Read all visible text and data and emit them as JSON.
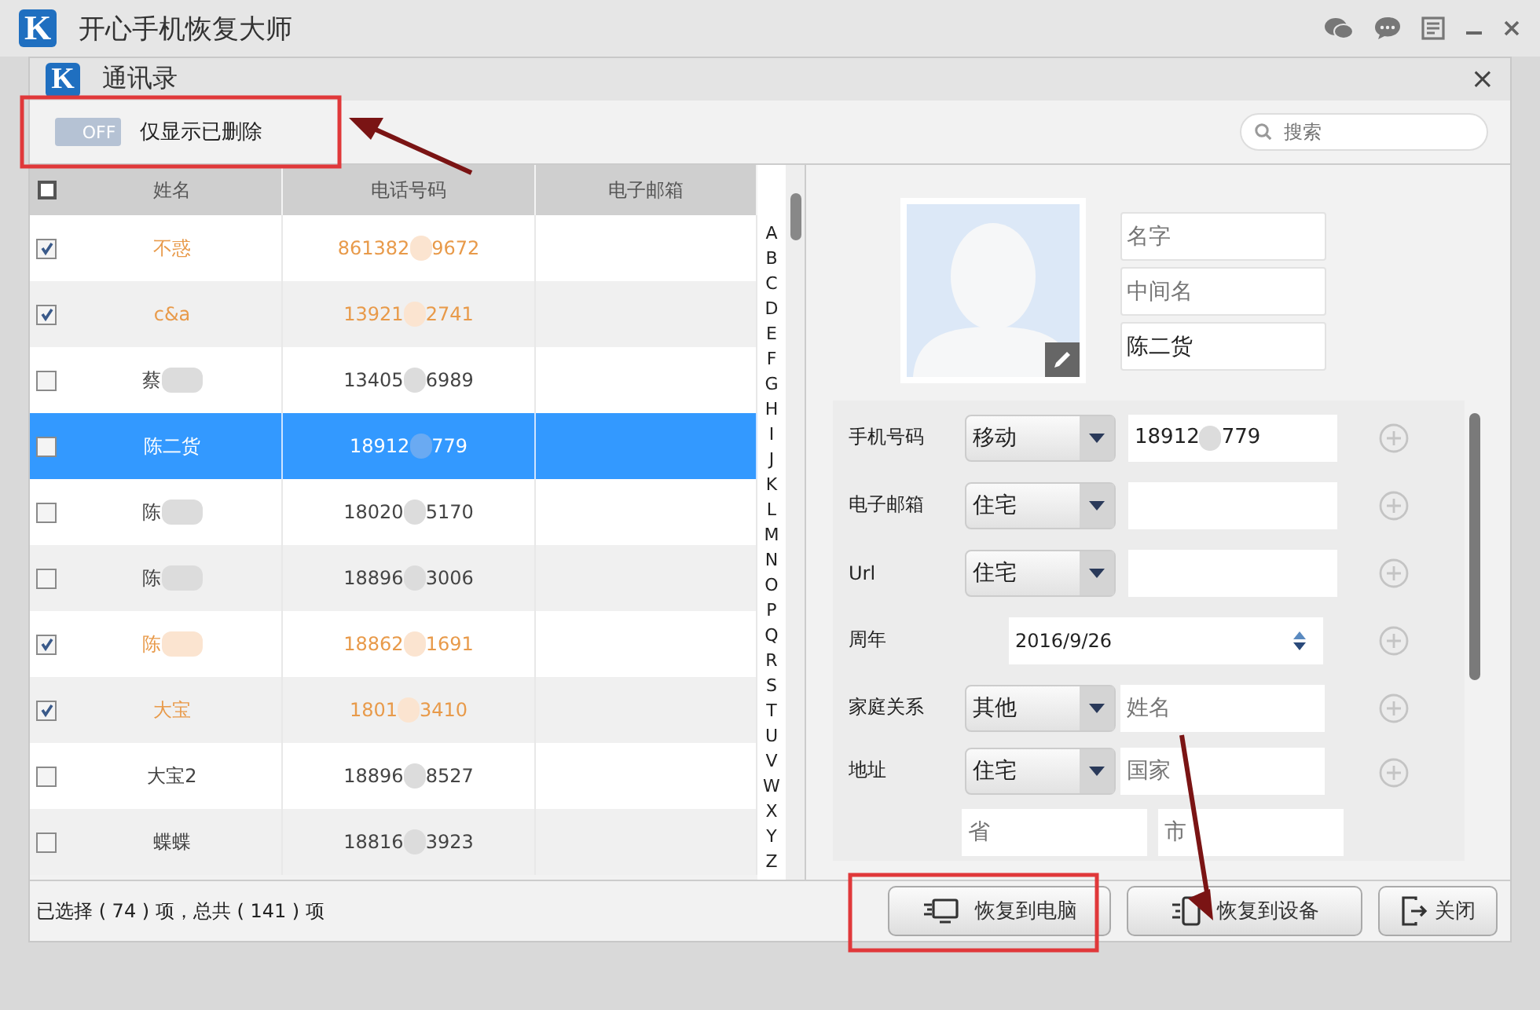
{
  "app": {
    "logo": "K",
    "title": "开心手机恢复大师"
  },
  "dialog": {
    "logo": "K",
    "title": "通讯录",
    "close": "×"
  },
  "toolbar": {
    "toggle": {
      "label": "OFF",
      "on": false
    },
    "filter_label": "仅显示已删除",
    "search": {
      "placeholder": "搜索"
    }
  },
  "table": {
    "columns": [
      "姓名",
      "电话号码",
      "电子邮箱"
    ],
    "all_checked": false,
    "rows": [
      {
        "name": "不惑",
        "name_blurred": false,
        "phone": [
          "861382",
          "9672"
        ],
        "checked": true,
        "selected": false
      },
      {
        "name": "c&a",
        "name_blurred": false,
        "phone": [
          "13921",
          "2741"
        ],
        "checked": true,
        "selected": false
      },
      {
        "name": "蔡",
        "name_blurred": true,
        "phone": [
          "13405",
          "6989"
        ],
        "checked": false,
        "selected": false
      },
      {
        "name": "陈二货",
        "name_blurred": false,
        "phone": [
          "18912",
          "779"
        ],
        "checked": false,
        "selected": true
      },
      {
        "name": "陈",
        "name_blurred": true,
        "phone": [
          "18020",
          "5170"
        ],
        "checked": false,
        "selected": false
      },
      {
        "name": "陈",
        "name_blurred": true,
        "phone": [
          "18896",
          "3006"
        ],
        "checked": false,
        "selected": false
      },
      {
        "name": "陈",
        "name_blurred": true,
        "phone": [
          "18862",
          "1691"
        ],
        "checked": true,
        "selected": false
      },
      {
        "name": "大宝",
        "name_blurred": false,
        "phone": [
          "1801",
          "3410"
        ],
        "checked": true,
        "selected": false
      },
      {
        "name": "大宝2",
        "name_blurred": false,
        "phone": [
          "18896",
          "8527"
        ],
        "checked": false,
        "selected": false
      },
      {
        "name": "蝶蝶",
        "name_blurred": false,
        "phone": [
          "18816",
          "3923"
        ],
        "checked": false,
        "selected": false
      }
    ]
  },
  "index_letters": [
    "A",
    "B",
    "C",
    "D",
    "E",
    "F",
    "G",
    "H",
    "I",
    "J",
    "K",
    "L",
    "M",
    "N",
    "O",
    "P",
    "Q",
    "R",
    "S",
    "T",
    "U",
    "V",
    "W",
    "X",
    "Y",
    "Z"
  ],
  "detail": {
    "name_fields": [
      {
        "placeholder": "名字"
      },
      {
        "placeholder": "中间名"
      },
      {
        "value": "陈二货"
      }
    ],
    "fields": [
      {
        "kind": "select",
        "label": "手机号码",
        "option": "移动",
        "value": [
          "18912",
          "779"
        ]
      },
      {
        "kind": "select",
        "label": "电子邮箱",
        "option": "住宅"
      },
      {
        "kind": "select",
        "label": "Url",
        "option": "住宅"
      },
      {
        "kind": "date",
        "label": "周年",
        "value": "2016/9/26"
      },
      {
        "kind": "select",
        "label": "家庭关系",
        "option": "其他",
        "placeholder": "姓名"
      },
      {
        "kind": "address",
        "label": "地址",
        "option": "住宅",
        "placeholder": "国家",
        "sub_placeholders": [
          "省",
          "市"
        ]
      }
    ]
  },
  "status": "已选择 ( 74 ) 项，总共 ( 141 ) 项",
  "buttons": [
    {
      "kind": "pc",
      "label": "恢复到电脑"
    },
    {
      "kind": "device",
      "label": "恢复到设备"
    },
    {
      "kind": "exit",
      "label": "关闭"
    }
  ]
}
